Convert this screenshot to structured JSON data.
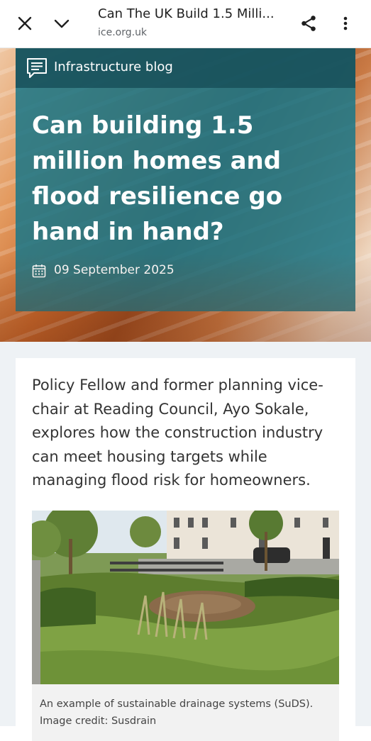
{
  "browser": {
    "tab_title": "Can The UK Build 1.5 Milli...",
    "url": "ice.org.uk",
    "icons": [
      "close-icon",
      "chevron-down-icon",
      "share-icon",
      "more-vert-icon"
    ]
  },
  "article": {
    "category": "Infrastructure blog",
    "title": "Can building 1.5 million homes and flood resilience go hand in hand?",
    "date": "09 September 2025",
    "intro": "Policy Fellow and former planning vice-chair at Reading Council, Ayo Sokale, explores how the construction industry can meet housing targets while managing flood risk for homeowners.",
    "caption": "An example of sustainable drainage systems (SuDS). Image credit: Susdrain"
  },
  "colors": {
    "hero_card": "#1e7887",
    "category_bar": "#164e58",
    "page_bg": "#eef2f5"
  }
}
